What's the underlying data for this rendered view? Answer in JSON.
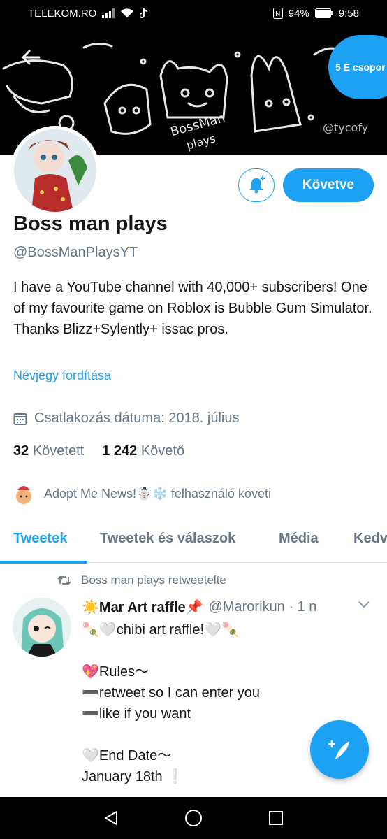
{
  "status_bar": {
    "carrier": "TELEKOM.RO",
    "battery": "94%",
    "time": "9:58"
  },
  "banner": {
    "group_bubble": "5 E csopor"
  },
  "profile": {
    "follow_label": "Követve",
    "display_name": "Boss man plays",
    "handle": "@BossManPlaysYT",
    "bio": "I have a YouTube channel with 40,000+ subscribers! One of my favourite game on Roblox is Bubble Gum Simulator. Thanks Blizz+Sylently+ issac pros.",
    "translate_bio": "Névjegy fordítása",
    "joined": "Csatlakozás dátuma: 2018. július",
    "following_count": "32",
    "following_label": "Követett",
    "followers_count": "1 242",
    "followers_label": "Követő",
    "followed_by": "Adopt Me News!☃️❄️ felhasználó követi"
  },
  "tabs": [
    {
      "label": "Tweetek",
      "active": true
    },
    {
      "label": "Tweetek és válaszok",
      "active": false
    },
    {
      "label": "Média",
      "active": false
    },
    {
      "label": "Kedv",
      "active": false
    }
  ],
  "tweet": {
    "retweet_note": "Boss man plays retweetelte",
    "author_name": "☀️Mar Art raffle📌",
    "author_handle": "@Marorikun · 1 n",
    "lines": [
      "🍡🤍chibi art raffle!🤍🍡",
      "",
      "💖Rules〜",
      "➖retweet so I can enter you",
      "➖like if you want",
      "",
      "🤍End Date〜",
      "January 18th ❕"
    ]
  },
  "colors": {
    "accent": "#1da1f2",
    "text": "#14171a",
    "secondary_text": "#657786",
    "banner_bg": "#000000"
  },
  "icons": [
    "back-arrow-icon",
    "bell-plus-icon",
    "calendar-icon",
    "retweet-icon",
    "chevron-down-icon",
    "compose-feather-icon",
    "nav-back-icon",
    "nav-home-icon",
    "nav-recents-icon"
  ]
}
